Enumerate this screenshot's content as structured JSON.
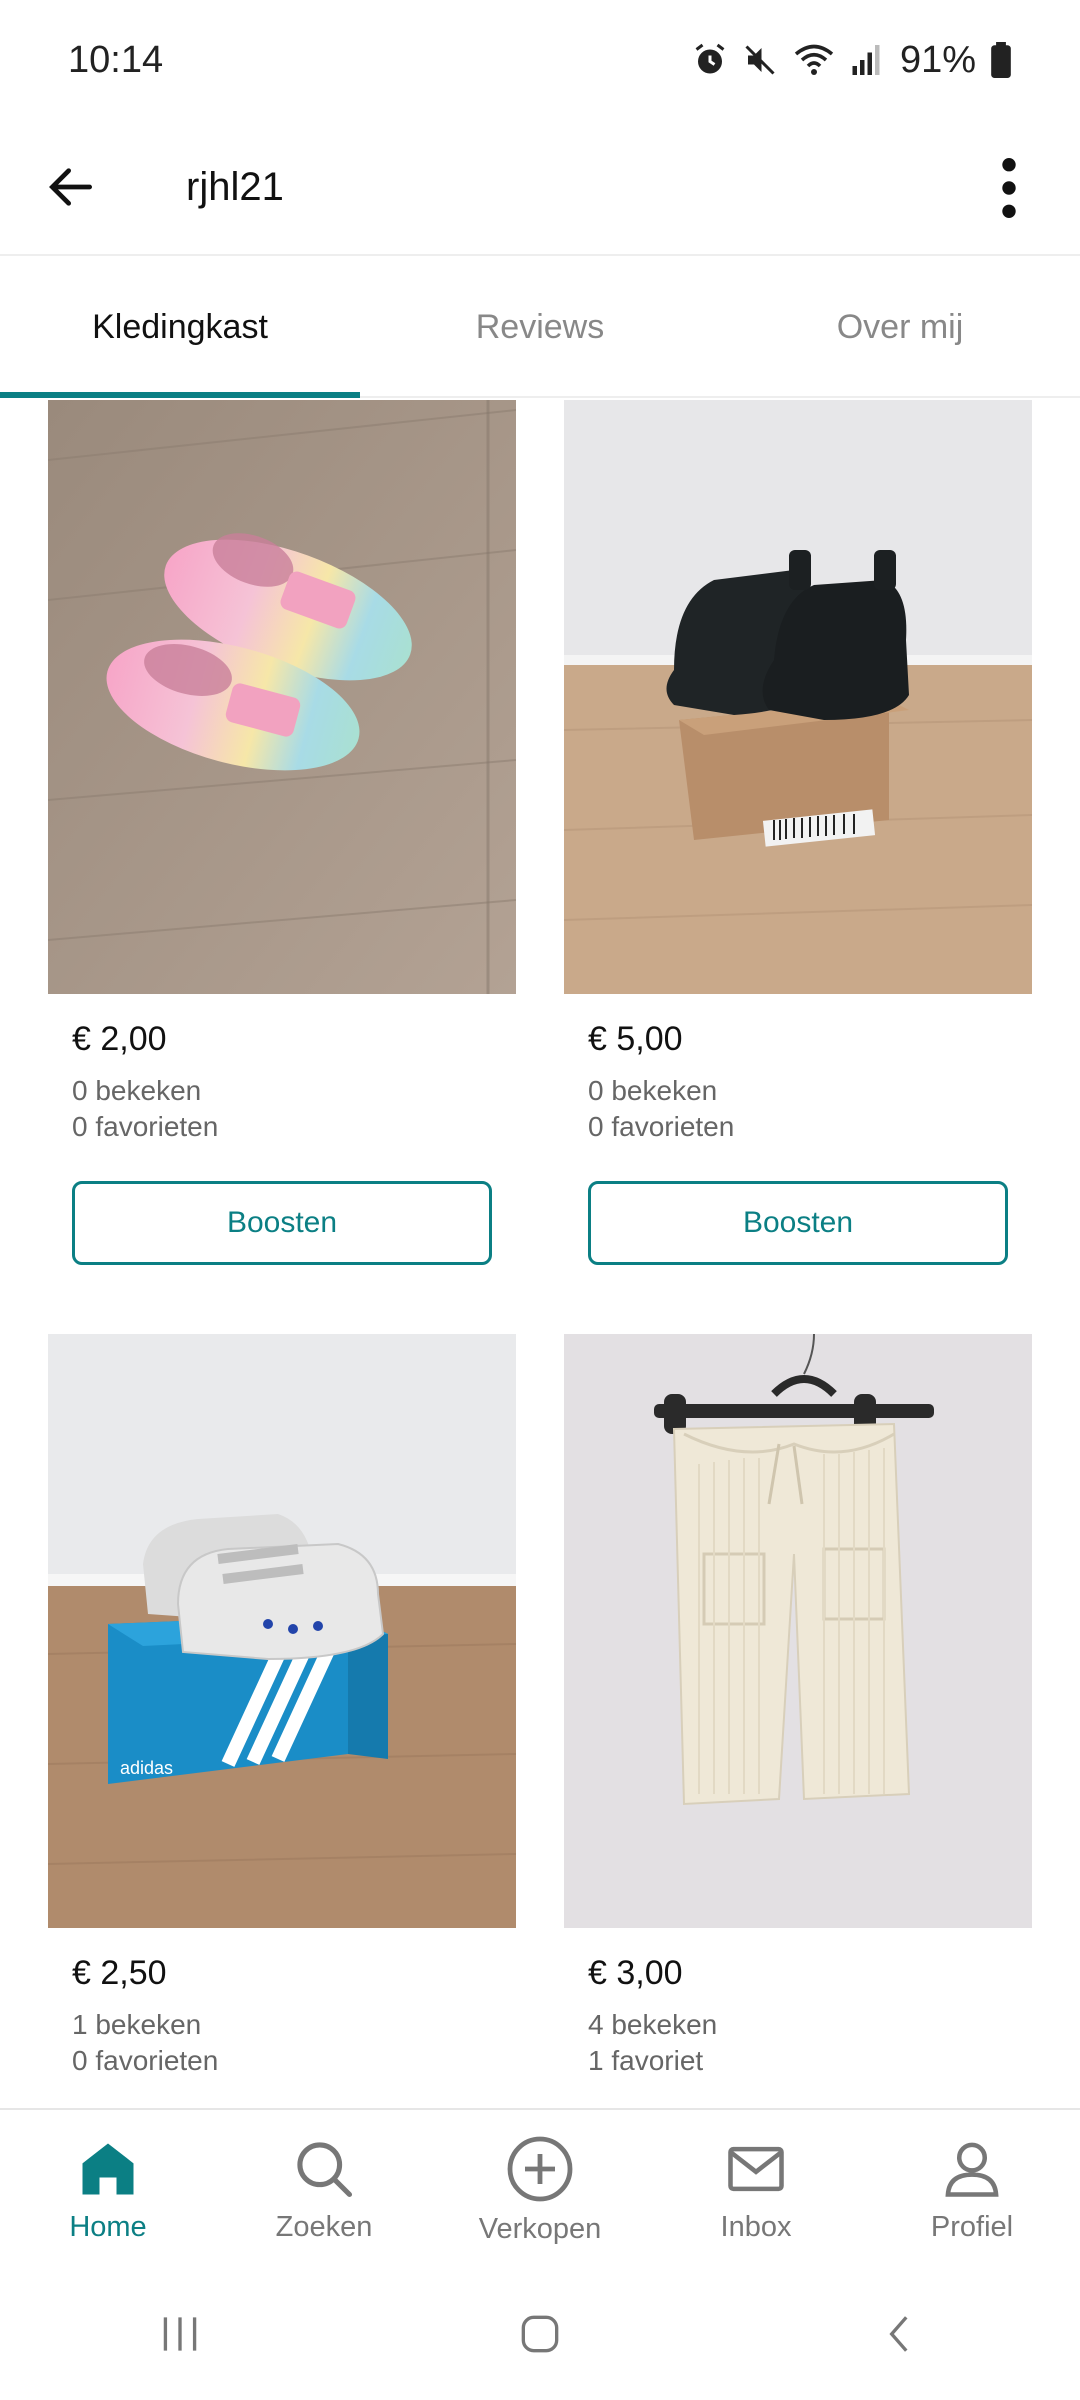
{
  "status_bar": {
    "time": "10:14",
    "battery": "91%",
    "icons": [
      "alarm-icon",
      "mute-icon",
      "wifi-icon",
      "signal-icon",
      "battery-icon"
    ]
  },
  "header": {
    "title": "rjhl21",
    "back_icon": "arrow-left-icon",
    "menu_icon": "more-vertical-icon"
  },
  "tabs": [
    {
      "label": "Kledingkast",
      "active": true
    },
    {
      "label": "Reviews",
      "active": false
    },
    {
      "label": "Over mij",
      "active": false
    }
  ],
  "items": [
    {
      "price": "€ 2,00",
      "views": "0 bekeken",
      "favorites": "0 favorieten",
      "boost_label": "Boosten",
      "photo": "pink rainbow slippers on wooden floor"
    },
    {
      "price": "€ 5,00",
      "views": "0 bekeken",
      "favorites": "0 favorieten",
      "boost_label": "Boosten",
      "photo": "black boots on shoe box"
    },
    {
      "price": "€ 2,50",
      "views": "1 bekeken",
      "favorites": "0 favorieten",
      "photo": "white sneakers on blue box"
    },
    {
      "price": "€ 3,00",
      "views": "4 bekeken",
      "favorites": "1 favoriet",
      "photo": "cream ribbed trousers on hanger"
    }
  ],
  "bottom_nav": [
    {
      "label": "Home",
      "icon": "home-icon",
      "active": true
    },
    {
      "label": "Zoeken",
      "icon": "search-icon",
      "active": false
    },
    {
      "label": "Verkopen",
      "icon": "plus-circle-icon",
      "active": false
    },
    {
      "label": "Inbox",
      "icon": "mail-icon",
      "active": false
    },
    {
      "label": "Profiel",
      "icon": "user-icon",
      "active": false
    }
  ],
  "colors": {
    "accent": "#0b7f84",
    "text": "#111111",
    "muted": "#666666"
  }
}
